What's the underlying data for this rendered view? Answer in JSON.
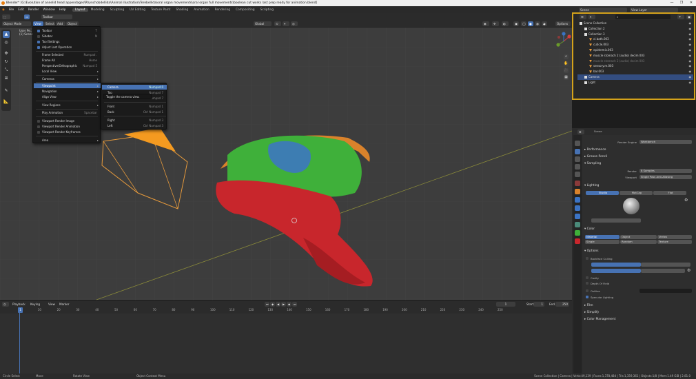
{
  "title_bar": {
    "text": "Blender* [G:\\Evolution of annelid head appendages\\Rhynchobdellida\\Animal illustration\\Terebellida\\oral organ movements\\oral organ full movements\\boolean cut works last prep ready for animation.blend]",
    "controls": [
      "—",
      "❐",
      "✕"
    ]
  },
  "menubar": {
    "menus": [
      "File",
      "Edit",
      "Render",
      "Window",
      "Help"
    ],
    "workspaces": [
      "Layout",
      "Modeling",
      "Sculpting",
      "UV Editing",
      "Texture Paint",
      "Shading",
      "Animation",
      "Rendering",
      "Compositing",
      "Scripting"
    ],
    "active_workspace": "Layout",
    "scene": "Scene",
    "view_layer": "View Layer"
  },
  "viewport_header": {
    "mode": "Object Mode",
    "menus": [
      "View",
      "Select",
      "Add",
      "Object"
    ],
    "transform": "Global",
    "options": "Options",
    "toolbar_label": "Toolbar",
    "info": "User Pe...",
    "info2": "(1) Scene"
  },
  "view_menu": {
    "items": [
      {
        "label": "Toolbar",
        "shortcut": "T",
        "check": true
      },
      {
        "label": "Sidebar",
        "shortcut": "N",
        "check": true
      },
      {
        "label": "Tool Settings",
        "shortcut": "",
        "check": true
      },
      {
        "label": "Adjust Last Operation",
        "shortcut": "",
        "check": true
      },
      {
        "label": "Frame Selected",
        "shortcut": "Numpad ."
      },
      {
        "label": "Frame All",
        "shortcut": "Home"
      },
      {
        "label": "Perspective/Orthographic",
        "shortcut": "Numpad 5"
      },
      {
        "label": "Local View",
        "shortcut": "",
        "arrow": true
      },
      {
        "label": "Cameras",
        "shortcut": "",
        "arrow": true
      },
      {
        "label": "Viewpoint",
        "shortcut": "",
        "arrow": true
      },
      {
        "label": "Navigation",
        "shortcut": "",
        "arrow": true
      },
      {
        "label": "Align View",
        "shortcut": "",
        "arrow": true
      },
      {
        "label": "View Regions",
        "shortcut": "",
        "arrow": true
      },
      {
        "label": "Play Animation",
        "shortcut": "Spacebar"
      },
      {
        "label": "Viewport Render Image",
        "shortcut": ""
      },
      {
        "label": "Viewport Render Animation",
        "shortcut": ""
      },
      {
        "label": "Viewport Render Keyframes",
        "shortcut": ""
      },
      {
        "label": "Area",
        "shortcut": "",
        "arrow": true
      }
    ]
  },
  "viewpoint_submenu": {
    "items": [
      {
        "label": "Camera",
        "shortcut": "Numpad 0"
      },
      {
        "label": "Top",
        "shortcut": "Numpad 7"
      },
      {
        "label": "Bottom",
        "shortcut": "Ctrl Numpad 7"
      },
      {
        "label": "Front",
        "shortcut": "Numpad 1"
      },
      {
        "label": "Back",
        "shortcut": "Ctrl Numpad 1"
      },
      {
        "label": "Right",
        "shortcut": "Numpad 3"
      },
      {
        "label": "Left",
        "shortcut": "Ctrl Numpad 3"
      }
    ],
    "tooltip": "Toggle the camera view."
  },
  "outliner": {
    "rows": [
      {
        "label": "Scene Collection",
        "indent": 0,
        "color": "#ffffff"
      },
      {
        "label": "Collection 2",
        "indent": 1,
        "color": "#ffffff"
      },
      {
        "label": "Collection 3",
        "indent": 1,
        "color": "#ffffff"
      },
      {
        "label": "cl.bath.003",
        "indent": 2
      },
      {
        "label": "cuticle.003",
        "indent": 2
      },
      {
        "label": "epidermis.003",
        "indent": 2
      },
      {
        "label": "muscle stomach 2 (audio) decim 003",
        "indent": 2
      },
      {
        "label": "muscle stomach 2 (audio) decim 003",
        "indent": 2,
        "dim": true
      },
      {
        "label": "sensory.m.003",
        "indent": 2
      },
      {
        "label": "bar.003",
        "indent": 2
      },
      {
        "label": "Camera",
        "indent": 1,
        "selected": true
      },
      {
        "label": "Light",
        "indent": 1
      }
    ]
  },
  "properties": {
    "scene_label": "Scene",
    "render_engine_label": "Render Engine",
    "render_engine": "Workbench",
    "sections": [
      "Performance",
      "Grease Pencil",
      "Sampling",
      "Lighting",
      "Color",
      "Options",
      "Film",
      "Simplify",
      "Color Management"
    ],
    "sampling": {
      "render_label": "Render",
      "render": "8 Samples",
      "viewport_label": "Viewport",
      "viewport": "Single Pass Anti-Aliasing"
    },
    "lighting_tabs": [
      "Studio",
      "MatCap",
      "Flat"
    ],
    "lighting_active": "Studio",
    "color_options": [
      "Material",
      "Object",
      "Vertex",
      "Single",
      "Random",
      "Texture"
    ],
    "color_active": "Material",
    "options": [
      "Backface Culling",
      "Outline",
      "Cavity",
      "Depth Of Field",
      "Outline",
      "Specular Lighting"
    ]
  },
  "timeline": {
    "menus": [
      "Playback",
      "Keying",
      "View",
      "Marker"
    ],
    "current_frame": "1",
    "start_label": "Start",
    "start": "1",
    "end_label": "End",
    "end": "250",
    "ticks": [
      "0",
      "10",
      "20",
      "30",
      "40",
      "50",
      "60",
      "70",
      "80",
      "90",
      "100",
      "110",
      "120",
      "130",
      "140",
      "150",
      "160",
      "170",
      "180",
      "190",
      "200",
      "210",
      "220",
      "230",
      "240",
      "250"
    ]
  },
  "statusbar": {
    "left": [
      "Circle Select",
      "Move",
      "Rotate View",
      "Object Context Menu"
    ],
    "right": "Scene Collection | Camera | Verts:49,139 | Faces:1,378,484 | Tris:1,359,361 | Objects:1/8 | Mem:1.49 GiB | 2.81.0"
  },
  "colors": {
    "accent": "#4772b3",
    "highlight": "#d4a21a",
    "orange_mesh": "#d9822b",
    "green_mesh": "#3fb03a",
    "red_mesh": "#c8262c",
    "blue_mesh": "#3d78c0"
  }
}
